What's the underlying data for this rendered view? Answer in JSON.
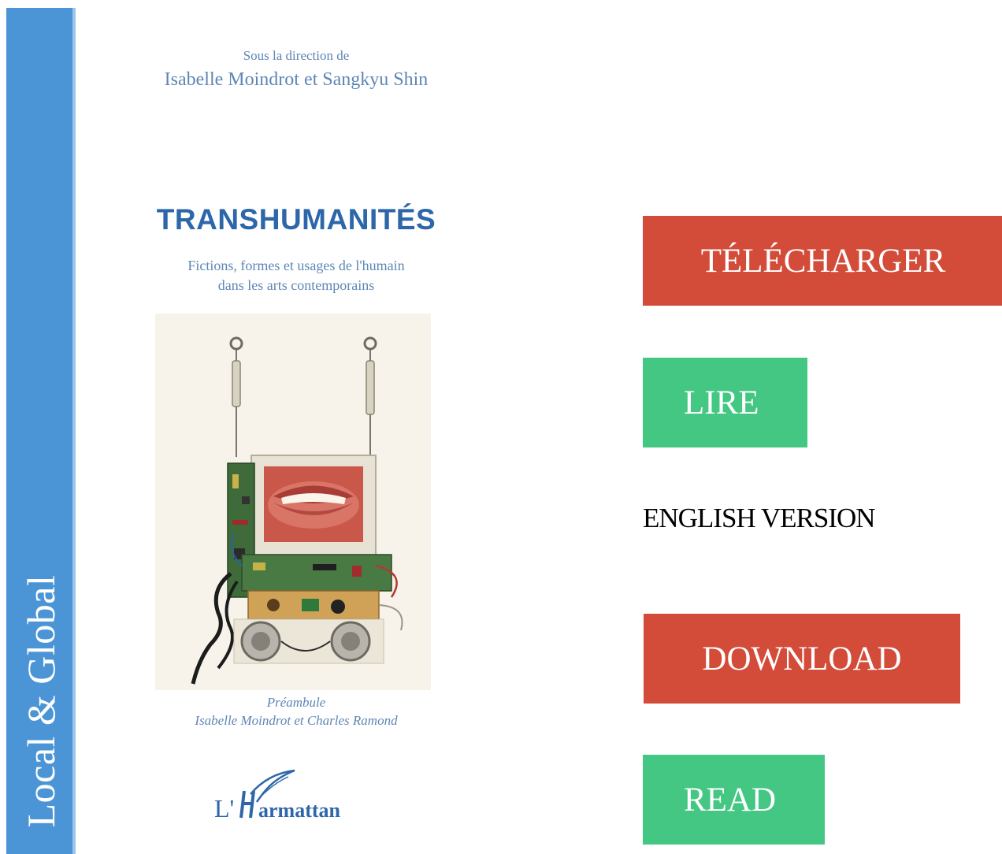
{
  "cover": {
    "series_label": "Local & Global",
    "direction_label": "Sous la direction de",
    "editors": "Isabelle Moindrot et Sangkyu Shin",
    "title": "TRANSHUMANITÉS",
    "subtitle_line1": "Fictions, formes et usages de l'humain",
    "subtitle_line2": "dans les arts contemporains",
    "preamble_label": "Préambule",
    "preamble_authors": "Isabelle Moindrot et Charles Ramond",
    "publisher": "L'Harmattan",
    "colors": {
      "spine": "#4b95d6",
      "text": "#5d86b5",
      "title": "#2d67a9"
    }
  },
  "actions": {
    "telecharger": "TÉLÉCHARGER",
    "lire": "LIRE",
    "english_version": "ENGLISH VERSION",
    "download": "DOWNLOAD",
    "read": "READ",
    "colors": {
      "red": "#d34b39",
      "green": "#43c783"
    }
  }
}
